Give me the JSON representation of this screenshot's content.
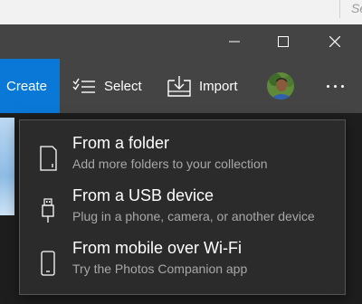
{
  "background_peek": "Se",
  "toolbar": {
    "create_label": "Create",
    "select_label": "Select",
    "import_label": "Import"
  },
  "menu": {
    "items": [
      {
        "title": "From a folder",
        "subtitle": "Add more folders to your collection",
        "icon": "folder-device-icon"
      },
      {
        "title": "From a USB device",
        "subtitle": "Plug in a phone, camera, or another device",
        "icon": "usb-icon"
      },
      {
        "title": "From mobile over Wi-Fi",
        "subtitle": "Try the Photos Companion app",
        "icon": "phone-icon"
      }
    ]
  },
  "colors": {
    "accent": "#0a78d7",
    "toolbar_bg": "#444444",
    "menu_bg": "#2b2b2b"
  }
}
